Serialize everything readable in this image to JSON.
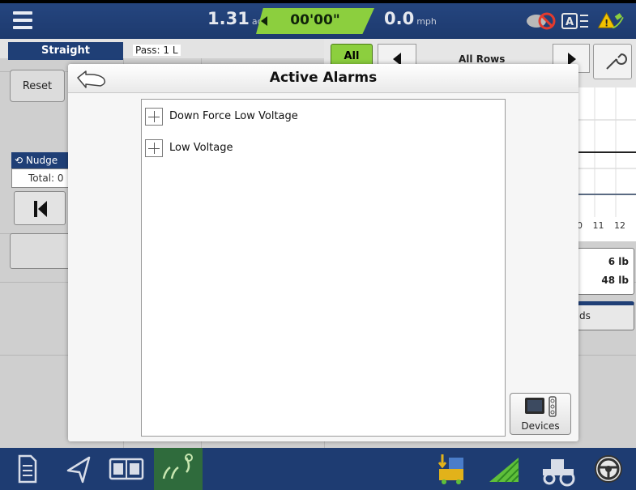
{
  "topbar": {
    "area_value": "1.31",
    "area_unit": "ac",
    "timer": "00'00\"",
    "speed_value": "0.0",
    "speed_unit": "mph"
  },
  "left_panel": {
    "guidance_tab": "Straight",
    "pass_label": "Pass: 1 L",
    "reset_label": "Reset",
    "nudge_label": "Nudge",
    "nudge_total": "Total: 0"
  },
  "right_panel": {
    "all_label": "All",
    "rows_label": "All Rows",
    "axis_ticks": "0 11 12",
    "weight_1": "6 lb",
    "weight_2": "48 lb",
    "seeds_label": "ds"
  },
  "dialog": {
    "title": "Active Alarms",
    "alarms": [
      {
        "label": "Down Force Low Voltage"
      },
      {
        "label": "Low Voltage"
      }
    ],
    "devices_label": "Devices"
  },
  "colors": {
    "header_blue": "#1e3c72",
    "accent_green": "#8ccf3e",
    "warning_yellow": "#f2c200"
  },
  "icons": {
    "menu": "hamburger-menu-icon",
    "back": "back-arrow-icon",
    "devices": "devices-icon",
    "bottom": [
      "document-icon",
      "navigation-icon",
      "split-screen-icon",
      "planting-icon",
      "seed-drop-icon",
      "field-icon",
      "tractor-icon",
      "steering-wheel-icon"
    ]
  }
}
